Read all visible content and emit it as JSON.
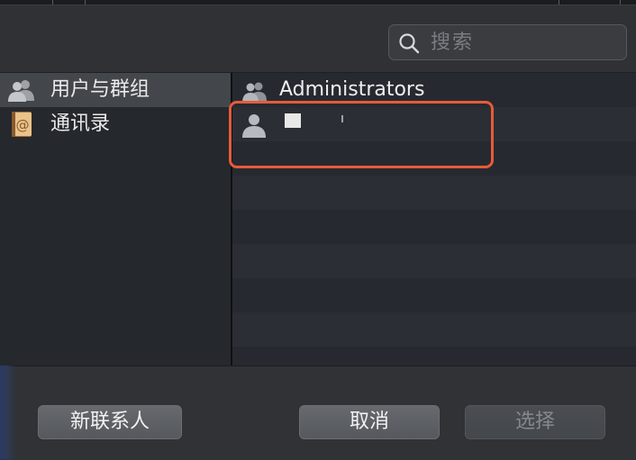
{
  "search": {
    "placeholder": "搜索"
  },
  "sidebar": {
    "items": [
      {
        "label": "用户与群组",
        "icon": "users-icon",
        "selected": true
      },
      {
        "label": "通讯录",
        "icon": "contacts-book-icon",
        "selected": false
      }
    ]
  },
  "list": {
    "rows": [
      {
        "label": "Administrators",
        "icon": "group-icon"
      },
      {
        "label": "",
        "icon": "user-icon"
      }
    ]
  },
  "footer": {
    "new_contact_label": "新联系人",
    "cancel_label": "取消",
    "select_label": "选择"
  },
  "colors": {
    "highlight": "#e85a3a",
    "background": "#2e3033",
    "selected_row": "#43464b"
  }
}
